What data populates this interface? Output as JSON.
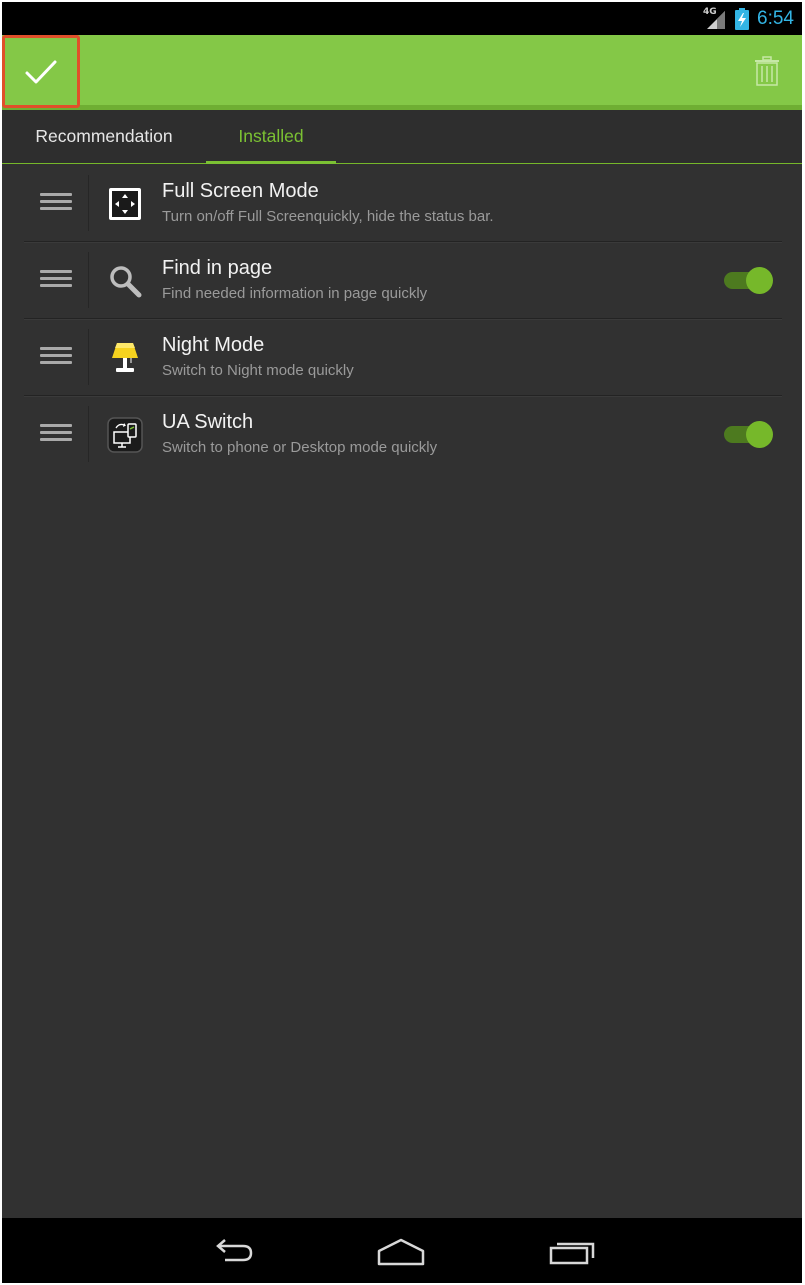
{
  "status_bar": {
    "network": "4G",
    "time": "6:54"
  },
  "action_bar": {
    "confirm_icon": "check-icon",
    "delete_icon": "trash-icon"
  },
  "tabs": [
    {
      "label": "Recommendation",
      "active": false
    },
    {
      "label": "Installed",
      "active": true
    }
  ],
  "accent_color": "#84c847",
  "active_tab_color": "#7bc133",
  "addons": [
    {
      "icon": "fullscreen-icon",
      "title": "Full Screen Mode",
      "subtitle": "Turn on/off Full Screenquickly, hide the status bar.",
      "toggle": null
    },
    {
      "icon": "search-icon",
      "title": "Find in page",
      "subtitle": "Find needed information in page quickly",
      "toggle": true
    },
    {
      "icon": "lamp-icon",
      "title": "Night Mode",
      "subtitle": "Switch to Night mode quickly",
      "toggle": null
    },
    {
      "icon": "ua-switch-icon",
      "title": "UA Switch",
      "subtitle": "Switch to phone or Desktop mode quickly",
      "toggle": true
    }
  ],
  "nav_bar": {
    "back_icon": "back-icon",
    "home_icon": "home-icon",
    "recent_icon": "recent-apps-icon"
  }
}
